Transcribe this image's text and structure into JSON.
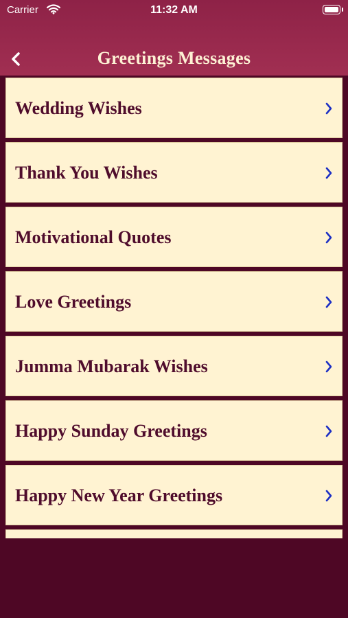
{
  "status": {
    "carrier": "Carrier",
    "time": "11:32 AM"
  },
  "nav": {
    "title": "Greetings Messages",
    "back_icon": "chevron-left-icon"
  },
  "items": [
    {
      "label": "Wedding Wishes"
    },
    {
      "label": "Thank You Wishes"
    },
    {
      "label": "Motivational Quotes"
    },
    {
      "label": "Love Greetings"
    },
    {
      "label": "Jumma Mubarak Wishes"
    },
    {
      "label": "Happy Sunday Greetings"
    },
    {
      "label": "Happy New Year Greetings"
    }
  ],
  "colors": {
    "header": "#9a2a4f",
    "background": "#4e0725",
    "row": "#fff3d2",
    "text": "#4f0c2c",
    "chevron": "#1c2fc4"
  }
}
